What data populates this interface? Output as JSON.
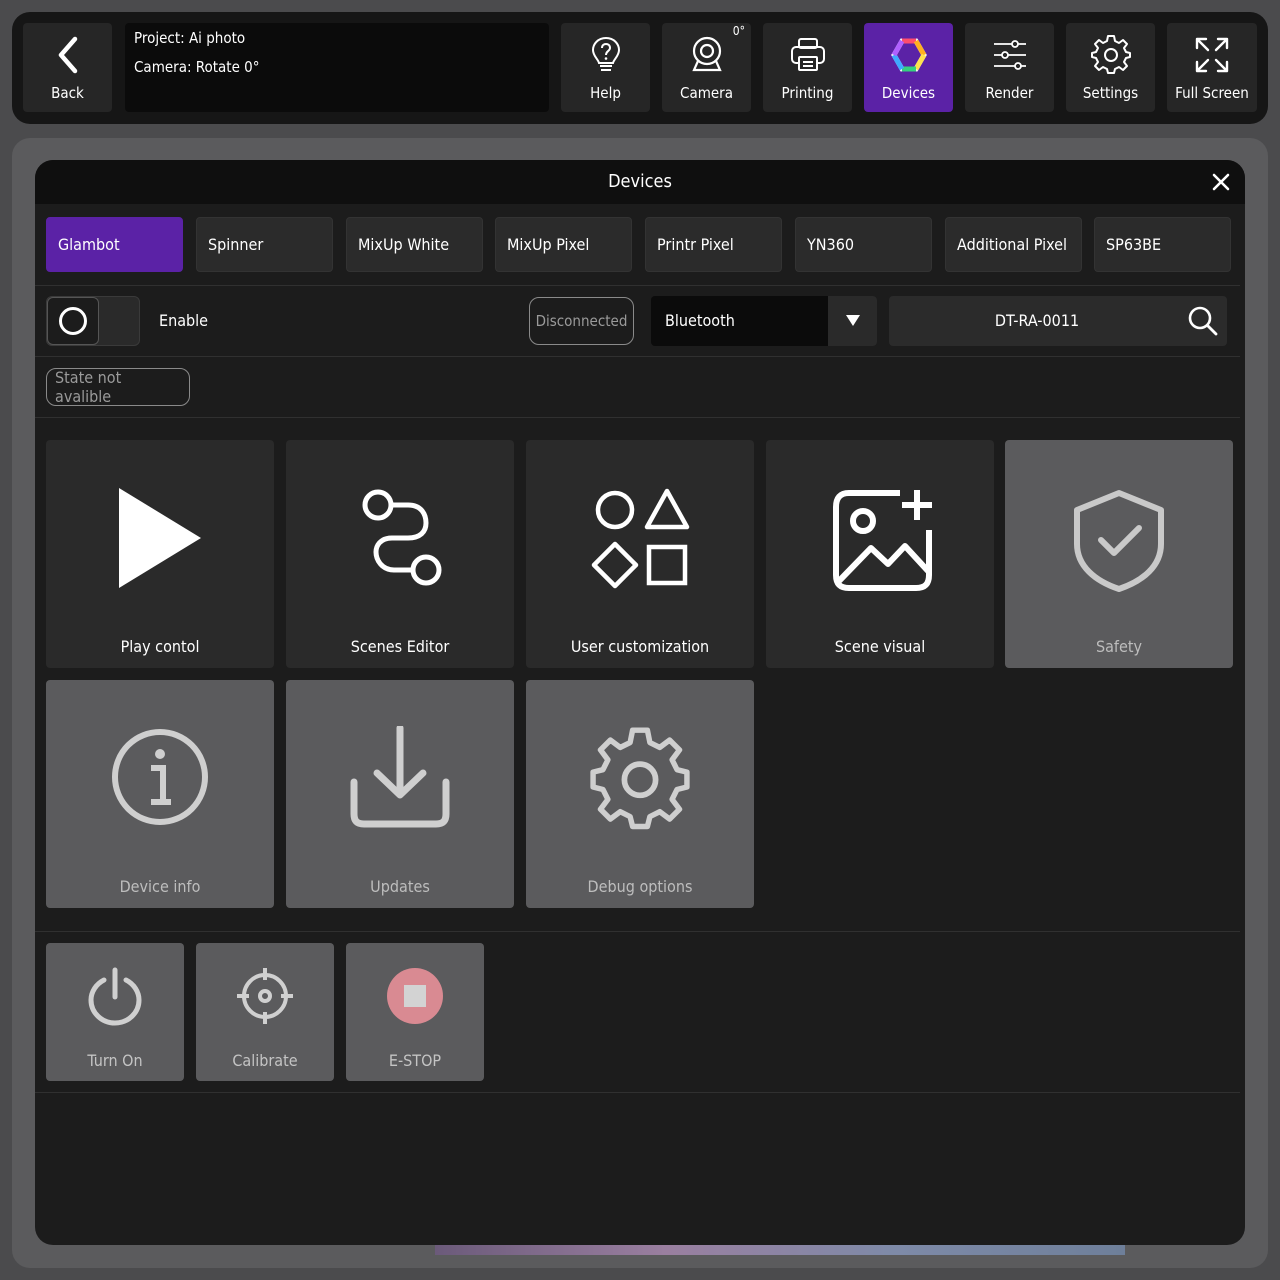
{
  "topbar": {
    "back_label": "Back",
    "project_line": "Project: Ai photo",
    "camera_line": "Camera: Rotate 0°",
    "help_label": "Help",
    "camera_label": "Camera",
    "camera_badge": "0°",
    "printing_label": "Printing",
    "devices_label": "Devices",
    "render_label": "Render",
    "settings_label": "Settings",
    "fullscreen_label": "Full Screen"
  },
  "modal": {
    "title": "Devices",
    "tabs": [
      {
        "label": "Glambot"
      },
      {
        "label": "Spinner"
      },
      {
        "label": "MixUp White"
      },
      {
        "label": "MixUp Pixel"
      },
      {
        "label": "Printr Pixel"
      },
      {
        "label": "YN360"
      },
      {
        "label": "Additional Pixel"
      },
      {
        "label": "SP63BE"
      }
    ],
    "enable_label": "Enable",
    "status": "Disconnected",
    "connection": "Bluetooth",
    "device_id": "DT-RA-0011",
    "state_label": "State not avalible",
    "tiles": [
      {
        "label": "Play contol"
      },
      {
        "label": "Scenes Editor"
      },
      {
        "label": "User customization"
      },
      {
        "label": "Scene visual"
      },
      {
        "label": "Safety"
      },
      {
        "label": "Device info"
      },
      {
        "label": "Updates"
      },
      {
        "label": "Debug options"
      }
    ],
    "actions": [
      {
        "label": "Turn On"
      },
      {
        "label": "Calibrate"
      },
      {
        "label": "E-STOP"
      }
    ]
  },
  "colors": {
    "accent": "#5b22a6",
    "modal_bg": "#1c1c1c",
    "estop": "#d98a92"
  }
}
